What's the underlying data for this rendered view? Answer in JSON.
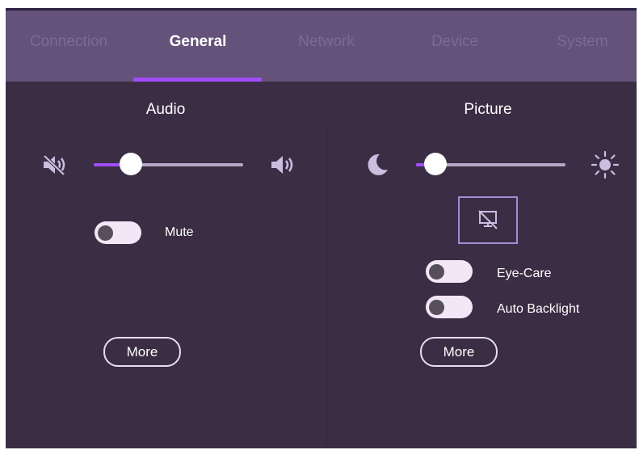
{
  "tabs": [
    {
      "label": "Connection",
      "active": false
    },
    {
      "label": "General",
      "active": true
    },
    {
      "label": "Network",
      "active": false
    },
    {
      "label": "Device",
      "active": false
    },
    {
      "label": "System",
      "active": false
    }
  ],
  "audio": {
    "title": "Audio",
    "volume_level": 0.25,
    "mute": {
      "label": "Mute",
      "on": false
    },
    "more_label": "More",
    "icons": [
      "volume-mute-icon",
      "volume-up-icon"
    ]
  },
  "picture": {
    "title": "Picture",
    "brightness_level": 0.13,
    "eye_care": {
      "label": "Eye-Care",
      "on": false
    },
    "auto_backlight": {
      "label": "Auto Backlight",
      "on": false
    },
    "more_label": "More",
    "icons": [
      "moon-icon",
      "sun-icon",
      "display-off-icon"
    ]
  },
  "colors": {
    "background": "#3a2d44",
    "tab_bar": "#64527a",
    "accent": "#a24cff"
  }
}
